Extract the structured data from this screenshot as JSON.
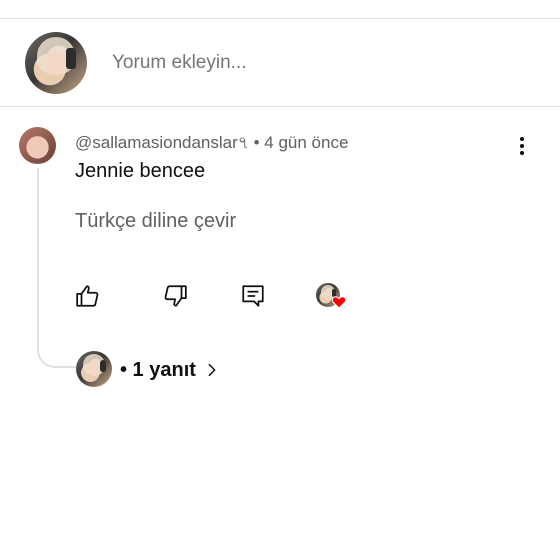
{
  "composer": {
    "placeholder": "Yorum ekleyin..."
  },
  "comment": {
    "author": "@sallamasiondanslar৭",
    "separator": "•",
    "time": "4 gün önce",
    "text": "Jennie bencee",
    "translate_label": "Türkçe diline çevir",
    "actions": {
      "like_icon": "thumbs-up-icon",
      "dislike_icon": "thumbs-down-icon",
      "reply_icon": "reply-comment-icon",
      "creator_heart_icon": "creator-heart-icon"
    },
    "replies": {
      "label": "• 1 yanıt"
    }
  },
  "colors": {
    "text_primary": "#0f0f0f",
    "text_secondary": "#606060",
    "placeholder": "#8a8a8a",
    "divider": "#e0e0e0",
    "heart": "#ff0000"
  }
}
